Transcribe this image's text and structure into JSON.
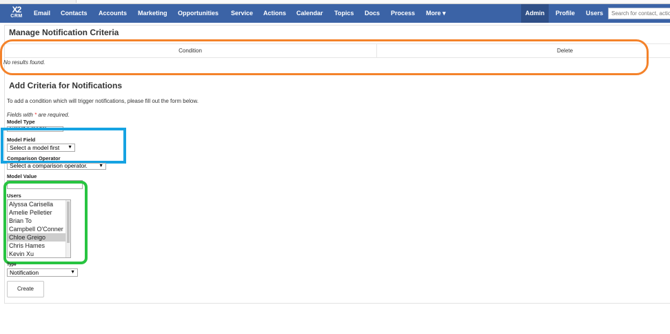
{
  "nav": {
    "logo_top": "X2",
    "logo_bottom": "CRM",
    "items": [
      "Email",
      "Contacts",
      "Accounts",
      "Marketing",
      "Opportunities",
      "Service",
      "Actions",
      "Calendar",
      "Topics",
      "Docs",
      "Process",
      "More ▾"
    ],
    "right_items": [
      "Admin",
      "Profile",
      "Users"
    ],
    "search_placeholder": "Search for contact, action, deal"
  },
  "manage": {
    "title": "Manage Notification Criteria",
    "columns": [
      "Condition",
      "Delete"
    ],
    "empty_text": "No results found."
  },
  "add": {
    "title": "Add Criteria for Notifications",
    "intro": "To add a condition which will trigger notifications, please fill out the form below.",
    "required_prefix": "Fields with ",
    "required_star": "*",
    "required_suffix": " are required.",
    "model_type_label": "Model Type",
    "model_type_value": "Select a model",
    "model_field_label": "Model Field",
    "model_field_value": "Select a model first",
    "comparison_label": "Comparison Operator",
    "comparison_value": "Select a comparison operator.",
    "model_value_label": "Model Value",
    "users_label": "Users",
    "users": [
      "Alyssa Carisella",
      "Amelie Pelletier",
      "Brian To",
      "Campbell O'Conner",
      "Chloe Greigo",
      "Chris Hames",
      "Kevin Xu"
    ],
    "selected_user": "Chloe Greigo",
    "type_label": "Type",
    "type_value": "Notification",
    "create_label": "Create"
  },
  "colors": {
    "nav_bg": "#3b63a6",
    "orange_highlight": "#f4822a",
    "blue_highlight": "#16a3e2",
    "green_highlight": "#28c441"
  }
}
